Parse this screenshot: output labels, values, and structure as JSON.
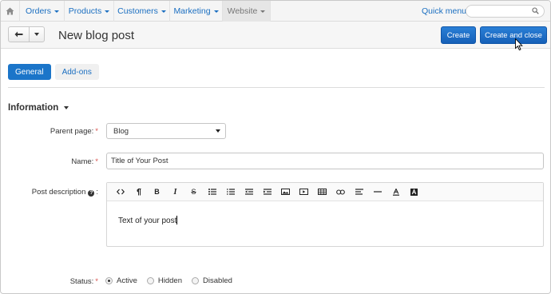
{
  "nav": {
    "items": [
      {
        "label": "Orders"
      },
      {
        "label": "Products"
      },
      {
        "label": "Customers"
      },
      {
        "label": "Marketing"
      },
      {
        "label": "Website"
      }
    ],
    "quick_menu": "Quick menu"
  },
  "toolbar": {
    "title": "New blog post",
    "create_label": "Create",
    "create_close_label": "Create and close"
  },
  "tabs": [
    {
      "label": "General",
      "active": true
    },
    {
      "label": "Add-ons",
      "active": false
    }
  ],
  "section": {
    "title": "Information"
  },
  "form": {
    "parent_page": {
      "label": "Parent page:",
      "value": "Blog"
    },
    "name": {
      "label": "Name:",
      "value": "Title of Your Post"
    },
    "description": {
      "label": "Post description",
      "text": "Text of your post"
    },
    "status": {
      "label": "Status:",
      "options": [
        {
          "label": "Active",
          "checked": true
        },
        {
          "label": "Hidden",
          "checked": false
        },
        {
          "label": "Disabled",
          "checked": false
        }
      ]
    }
  },
  "editor_tools": [
    "code-view-icon",
    "paragraph-icon",
    "bold-icon",
    "italic-icon",
    "strikethrough-icon",
    "bullet-list-icon",
    "numbered-list-icon",
    "outdent-icon",
    "indent-icon",
    "insert-image-icon",
    "insert-video-icon",
    "insert-table-icon",
    "insert-link-icon",
    "align-icon",
    "horizontal-rule-icon",
    "font-color-icon",
    "background-color-icon"
  ],
  "colors": {
    "accent": "#1b75c9",
    "link": "#1b6fc1",
    "required": "#d9534f"
  }
}
